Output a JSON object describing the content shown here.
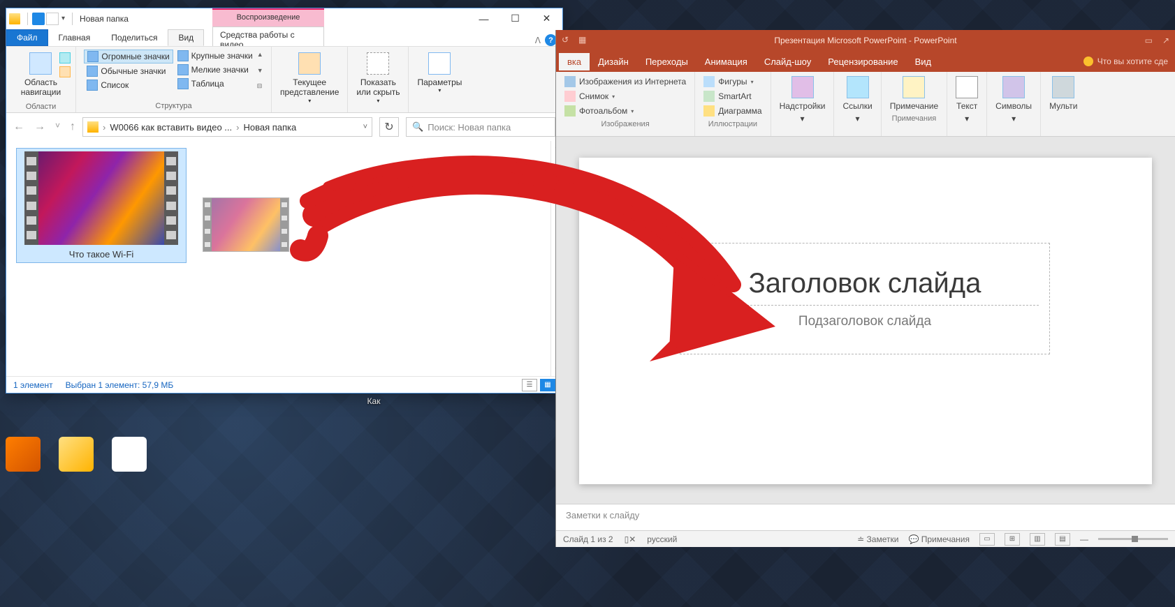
{
  "explorer": {
    "title": "Новая папка",
    "context_tab_header": "Воспроизведение",
    "context_tab_sub": "Средства работы с видео",
    "tabs": {
      "file": "Файл",
      "home": "Главная",
      "share": "Поделиться",
      "view": "Вид"
    },
    "ribbon": {
      "areas": {
        "nav_pane": "Область\nнавигации",
        "label": "Области"
      },
      "layout": {
        "huge": "Огромные значки",
        "large": "Крупные значки",
        "regular": "Обычные значки",
        "small": "Мелкие значки",
        "list": "Список",
        "table": "Таблица",
        "label": "Структура"
      },
      "current_view": {
        "btn": "Текущее\nпредставление"
      },
      "show_hide": {
        "btn": "Показать\nили скрыть"
      },
      "options": {
        "btn": "Параметры"
      }
    },
    "breadcrumb": {
      "part1": "W0066 как вставить видео ...",
      "part2": "Новая папка"
    },
    "search_placeholder": "Поиск: Новая папка",
    "file": {
      "name": "Что такое Wi-Fi"
    },
    "status": {
      "count": "1 элемент",
      "selected": "Выбран 1 элемент: 57,9 МБ"
    }
  },
  "powerpoint": {
    "title": "Презентация Microsoft PowerPoint - PowerPoint",
    "tabs": {
      "insert": "вка",
      "design": "Дизайн",
      "transitions": "Переходы",
      "animation": "Анимация",
      "slideshow": "Слайд-шоу",
      "review": "Рецензирование",
      "view": "Вид"
    },
    "tell_me": "Что вы хотите сде",
    "ribbon": {
      "images": {
        "online": "Изображения из Интернета",
        "screenshot": "Снимок",
        "album": "Фотоальбом",
        "label": "Изображения"
      },
      "illustrations": {
        "shapes": "Фигуры",
        "smartart": "SmartArt",
        "chart": "Диаграмма",
        "label": "Иллюстрации"
      },
      "addins": {
        "btn": "Надстройки"
      },
      "links": {
        "btn": "Ссылки"
      },
      "comments": {
        "btn": "Примечание",
        "label": "Примечания"
      },
      "text": {
        "btn": "Текст"
      },
      "symbols": {
        "btn": "Символы"
      },
      "media": {
        "btn": "Мульти"
      }
    },
    "slide": {
      "title_ph": "Заголовок слайда",
      "subtitle_ph": "Подзаголовок слайда"
    },
    "notes_ph": "Заметки к слайду",
    "status": {
      "slide_of": "Слайд 1 из 2",
      "lang": "русский",
      "notes_btn": "Заметки",
      "comments_btn": "Примечания"
    }
  }
}
